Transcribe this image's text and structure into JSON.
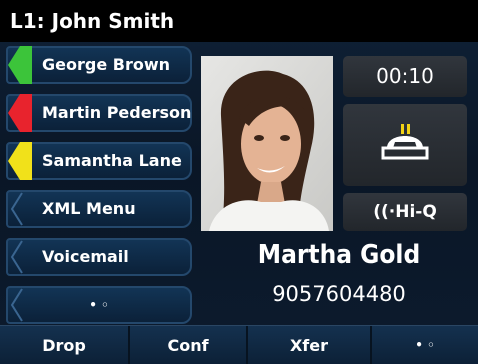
{
  "title": "L1: John Smith",
  "line_keys": [
    {
      "label": "George Brown",
      "status_color": "#3cc43a"
    },
    {
      "label": "Martin Pederson",
      "status_color": "#e8232d"
    },
    {
      "label": "Samantha Lane",
      "status_color": "#f1e11a"
    },
    {
      "label": "XML Menu",
      "status_color": ""
    },
    {
      "label": "Voicemail",
      "status_color": ""
    },
    {
      "label": "• ◦",
      "status_color": ""
    }
  ],
  "call": {
    "timer": "00:10",
    "hold_icon": "hold-icon",
    "hiq_label": "((·Hi-Q",
    "caller_name": "Martha Gold",
    "caller_number": "9057604480"
  },
  "softkeys": [
    "Drop",
    "Conf",
    "Xfer",
    "• ◦"
  ]
}
